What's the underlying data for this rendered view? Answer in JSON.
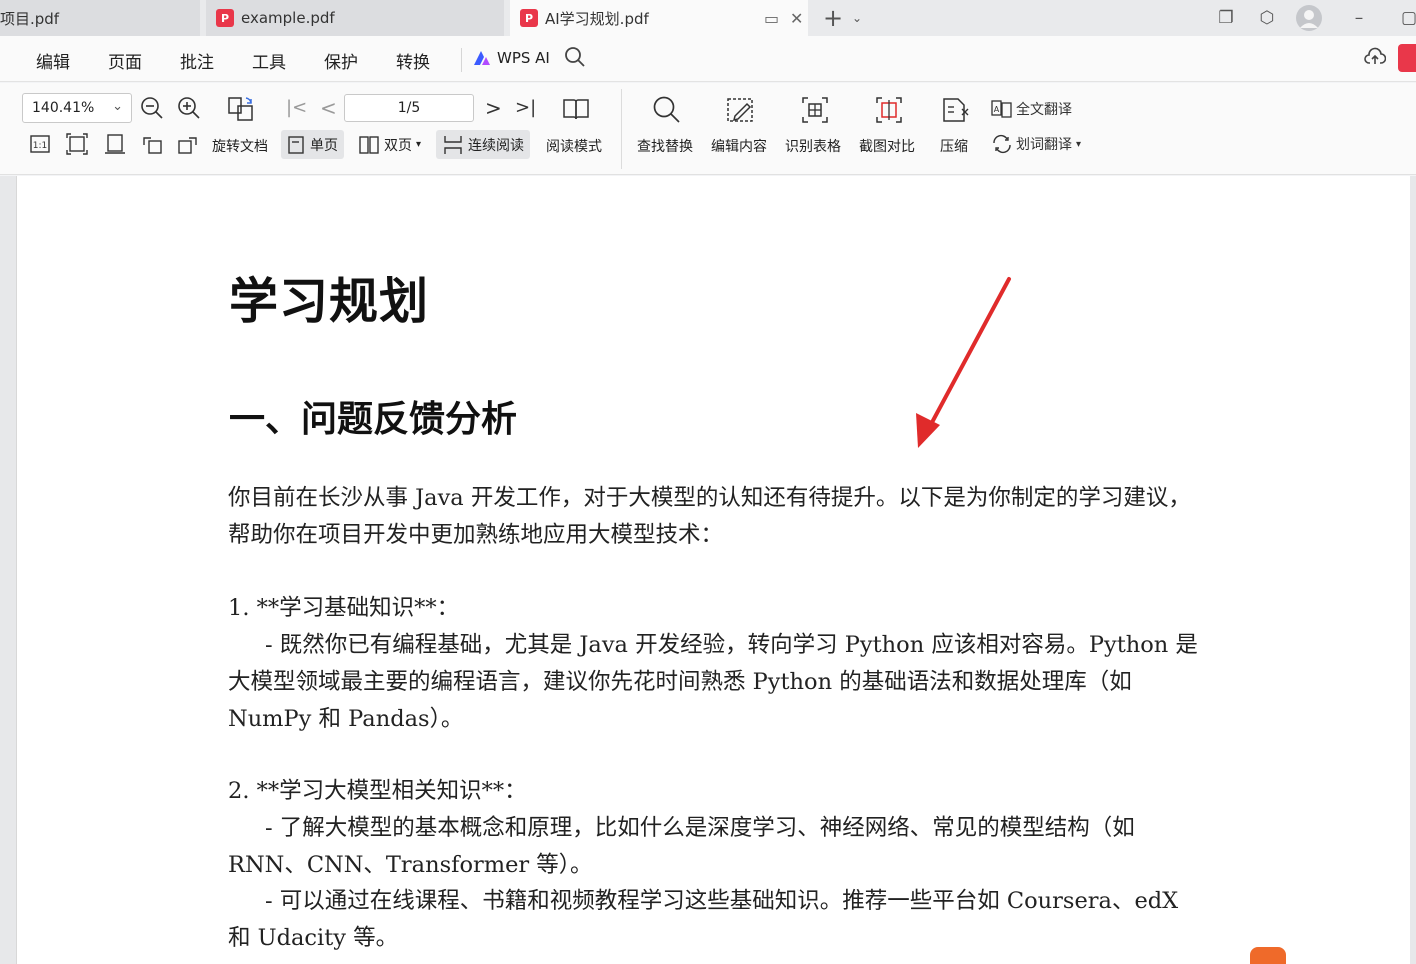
{
  "tabs": [
    {
      "label": "项目.pdf",
      "state": "inactive"
    },
    {
      "label": "example.pdf",
      "state": "inactive"
    },
    {
      "label": "AI学习规划.pdf",
      "state": "active"
    }
  ],
  "menu": {
    "items": [
      "编辑",
      "页面",
      "批注",
      "工具",
      "保护",
      "转换"
    ],
    "wps_ai_label": "WPS AI"
  },
  "toolbar": {
    "zoom_value": "140.41%",
    "page_value": "1/5",
    "rotate_label": "旋转文档",
    "single_page_label": "单页",
    "double_page_label": "双页",
    "continuous_label": "连续阅读",
    "reading_mode_label": "阅读模式",
    "find_replace_label": "查找替换",
    "edit_content_label": "编辑内容",
    "recognize_table_label": "识别表格",
    "screenshot_compare_label": "截图对比",
    "compress_label": "压缩",
    "full_translate_label": "全文翻译",
    "word_translate_label": "划词翻译",
    "fit_icon_label": "1:1"
  },
  "document": {
    "title": "学习规划",
    "section_heading": "一、问题反馈分析",
    "intro": "你目前在长沙从事 Java 开发工作，对于大模型的认知还有待提升。以下是为你制定的学习建议，帮助你在项目开发中更加熟练地应用大模型技术：",
    "item1_heading": "1. **学习基础知识**：",
    "item1_body": "- 既然你已有编程基础，尤其是 Java 开发经验，转向学习 Python 应该相对容易。Python 是大模型领域最主要的编程语言，建议你先花时间熟悉 Python 的基础语法和数据处理库（如 NumPy 和 Pandas）。",
    "item2_heading": "2. **学习大模型相关知识**：",
    "item2_body_a": "- 了解大模型的基本概念和原理，比如什么是深度学习、神经网络、常见的模型结构（如 RNN、CNN、Transformer 等）。",
    "item2_body_b": "- 可以通过在线课程、书籍和视频教程学习这些基础知识。推荐一些平台如 Coursera、edX 和 Udacity 等。"
  },
  "colors": {
    "accent_red": "#e02b2b",
    "pdf_icon": "#e9374a"
  }
}
